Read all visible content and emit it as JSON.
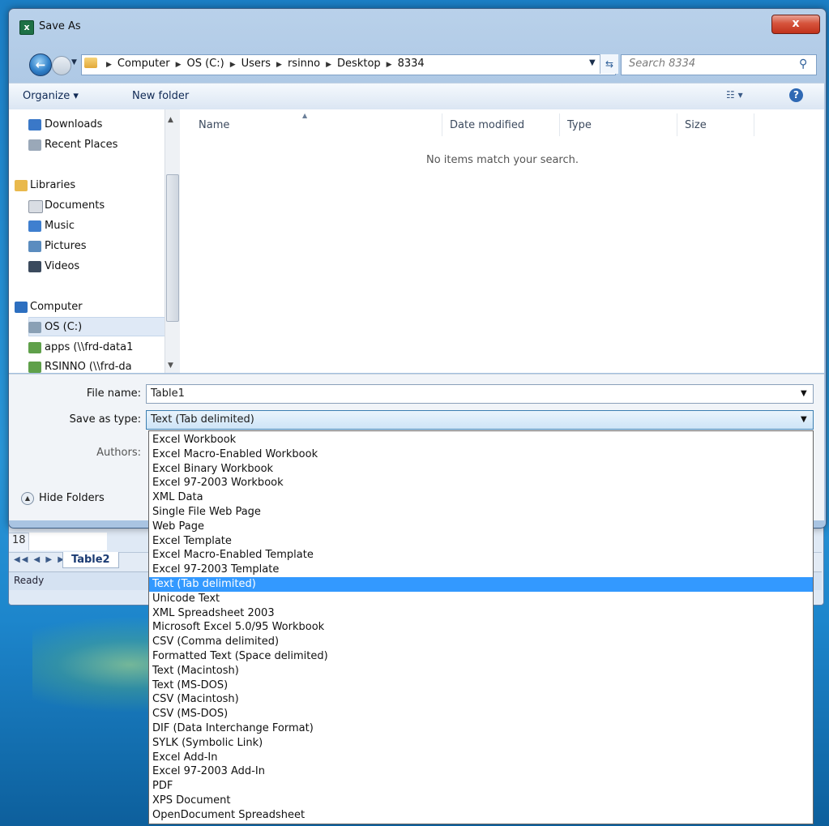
{
  "window": {
    "title": "Save As",
    "close_glyph": "x",
    "app_icon_letter": "x"
  },
  "nav": {
    "breadcrumbs": [
      "Computer",
      "OS (C:)",
      "Users",
      "rsinno",
      "Desktop",
      "8334"
    ],
    "search_placeholder": "Search 8334"
  },
  "toolbar": {
    "organize": "Organize ▾",
    "new_folder": "New folder",
    "help": "?"
  },
  "sidebar": {
    "items": [
      {
        "label": "Downloads",
        "icon": "downloads-icon"
      },
      {
        "label": "Recent Places",
        "icon": "recent-places-icon"
      },
      {
        "label": "Libraries",
        "icon": "libraries-icon"
      },
      {
        "label": "Documents",
        "icon": "documents-icon"
      },
      {
        "label": "Music",
        "icon": "music-icon"
      },
      {
        "label": "Pictures",
        "icon": "pictures-icon"
      },
      {
        "label": "Videos",
        "icon": "videos-icon"
      },
      {
        "label": "Computer",
        "icon": "computer-icon"
      },
      {
        "label": "OS (C:)",
        "icon": "drive-icon",
        "selected": true
      },
      {
        "label": "apps (\\\\frd-data1",
        "icon": "network-drive-icon"
      },
      {
        "label": "RSINNO (\\\\frd-da",
        "icon": "network-drive-icon"
      }
    ]
  },
  "file_list": {
    "columns": [
      "Name",
      "Date modified",
      "Type",
      "Size"
    ],
    "empty_message": "No items match your search."
  },
  "form": {
    "file_name_label": "File name:",
    "file_name_value": "Table1",
    "save_type_label": "Save as type:",
    "save_type_value": "Text (Tab delimited)",
    "authors_label": "Authors:",
    "hide_folders": "Hide Folders"
  },
  "save_type_options": [
    "Excel Workbook",
    "Excel Macro-Enabled Workbook",
    "Excel Binary Workbook",
    "Excel 97-2003 Workbook",
    "XML Data",
    "Single File Web Page",
    "Web Page",
    "Excel Template",
    "Excel Macro-Enabled Template",
    "Excel 97-2003 Template",
    "Text (Tab delimited)",
    "Unicode Text",
    "XML Spreadsheet 2003",
    "Microsoft Excel 5.0/95 Workbook",
    "CSV (Comma delimited)",
    "Formatted Text (Space delimited)",
    "Text (Macintosh)",
    "Text (MS-DOS)",
    "CSV (Macintosh)",
    "CSV (MS-DOS)",
    "DIF (Data Interchange Format)",
    "SYLK (Symbolic Link)",
    "Excel Add-In",
    "Excel 97-2003 Add-In",
    "PDF",
    "XPS Document",
    "OpenDocument Spreadsheet"
  ],
  "selected_option_index": 10,
  "excel_background": {
    "row_number": "18",
    "sheet_tab": "Table2",
    "status": "Ready"
  },
  "colors": {
    "selection": "#3399ff",
    "desktop": "#1c7fc6"
  }
}
